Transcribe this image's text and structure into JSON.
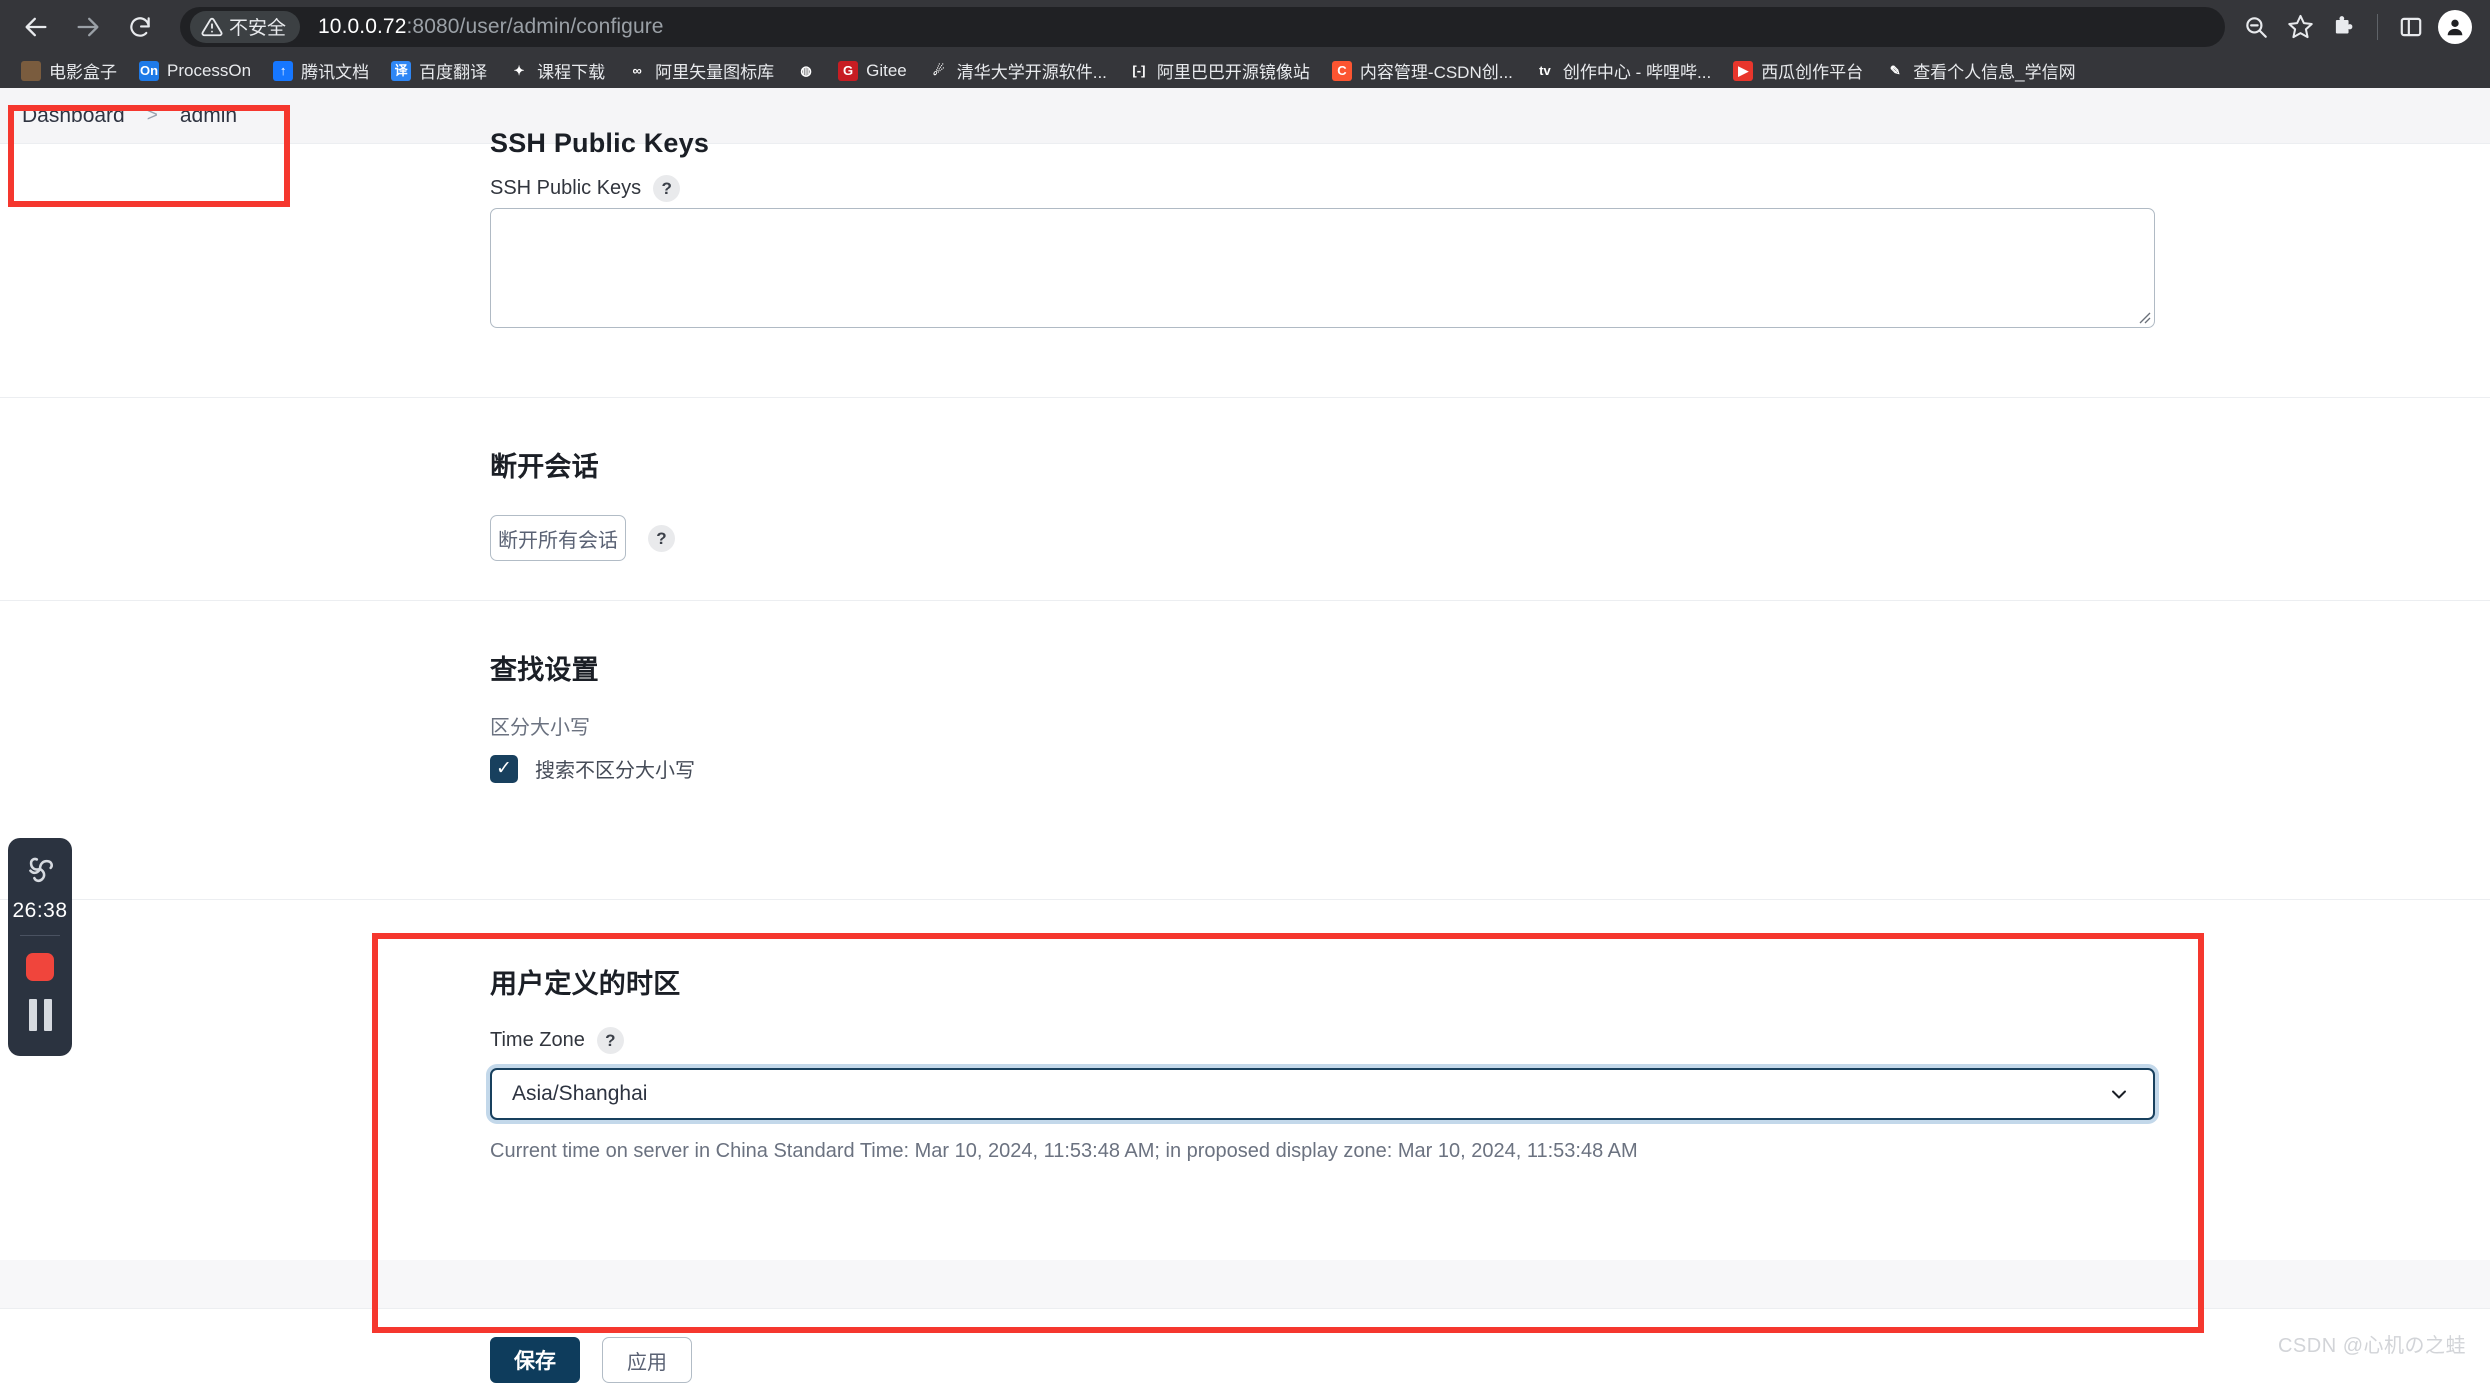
{
  "browser": {
    "nav": {
      "back_label": "Back",
      "forward_label": "Forward",
      "reload_label": "Reload"
    },
    "omnibox": {
      "security_chip_text": "不安全",
      "url_host": "10.0.0.72",
      "url_path": ":8080/user/admin/configure",
      "zoom_out_label": "Zoom out",
      "bookmark_label": "Bookmark this tab"
    },
    "right_actions": {
      "extensions_label": "Extensions",
      "side_panel_label": "Side panel",
      "profile_label": "Profile"
    },
    "bookmarks": [
      {
        "label": "电影盒子",
        "icon": "movie-box-icon",
        "icon_text": "",
        "bg": "#7a5c3e"
      },
      {
        "label": "ProcessOn",
        "icon": "processon-icon",
        "icon_text": "On",
        "bg": "#1e7ae8"
      },
      {
        "label": "腾讯文档",
        "icon": "tencent-docs-icon",
        "icon_text": "↑",
        "bg": "#1677ff"
      },
      {
        "label": "百度翻译",
        "icon": "baidu-translate-icon",
        "icon_text": "译",
        "bg": "#2f87f5"
      },
      {
        "label": "课程下载",
        "icon": "course-download-icon",
        "icon_text": "✦",
        "bg": "#35363a"
      },
      {
        "label": "阿里矢量图标库",
        "icon": "iconfont-icon",
        "icon_text": "∞",
        "bg": "#35363a"
      },
      {
        "label": "",
        "icon": "globe-icon",
        "icon_text": "◍",
        "bg": "#35363a"
      },
      {
        "label": "Gitee",
        "icon": "gitee-icon",
        "icon_text": "G",
        "bg": "#c71d23"
      },
      {
        "label": "清华大学开源软件...",
        "icon": "tuna-mirror-icon",
        "icon_text": "☄",
        "bg": "#35363a"
      },
      {
        "label": "阿里巴巴开源镜像站",
        "icon": "alibaba-mirror-icon",
        "icon_text": "[-]",
        "bg": "#35363a"
      },
      {
        "label": "内容管理-CSDN创...",
        "icon": "csdn-icon",
        "icon_text": "C",
        "bg": "#fc5531"
      },
      {
        "label": "创作中心 - 哔哩哔...",
        "icon": "bilibili-icon",
        "icon_text": "tv",
        "bg": "#35363a"
      },
      {
        "label": "西瓜创作平台",
        "icon": "xigua-icon",
        "icon_text": "▶",
        "bg": "#e8362c"
      },
      {
        "label": "查看个人信息_学信网",
        "icon": "chsi-icon",
        "icon_text": "✎",
        "bg": "#35363a"
      }
    ]
  },
  "breadcrumb": {
    "items": [
      "Dashboard",
      "admin"
    ],
    "separator": ">"
  },
  "sections": {
    "ssh": {
      "title": "SSH Public Keys",
      "field_label": "SSH Public Keys",
      "help_glyph": "?",
      "textarea_value": "",
      "textarea_placeholder": ""
    },
    "sessions": {
      "title": "断开会话",
      "button_label": "断开所有会话",
      "help_glyph": "?"
    },
    "search_settings": {
      "title": "查找设置",
      "subtitle": "区分大小写",
      "checkbox_label": "搜索不区分大小写",
      "checkbox_checked": true,
      "check_glyph": "✓"
    },
    "timezone": {
      "title": "用户定义的时区",
      "field_label": "Time Zone",
      "help_glyph": "?",
      "selected_value": "Asia/Shanghai",
      "caption": "Current time on server in China Standard Time: Mar 10, 2024, 11:53:48 AM; in proposed display zone: Mar 10, 2024, 11:53:48 AM"
    }
  },
  "form_actions": {
    "save_label": "保存",
    "apply_label": "应用"
  },
  "recorder": {
    "elapsed": "26:38",
    "stop_label": "Stop recording",
    "pause_label": "Pause recording",
    "logo_name": "recorder-logo-icon"
  },
  "watermark": "CSDN @心机の之蛙",
  "colors": {
    "accent": "#0e3c5c",
    "highlight_red": "#f5372e",
    "chrome_bg": "#35363a",
    "omnibox_bg": "#202124",
    "checkbox_fill": "#18405e",
    "focus_ring": "#c3d8ea"
  }
}
